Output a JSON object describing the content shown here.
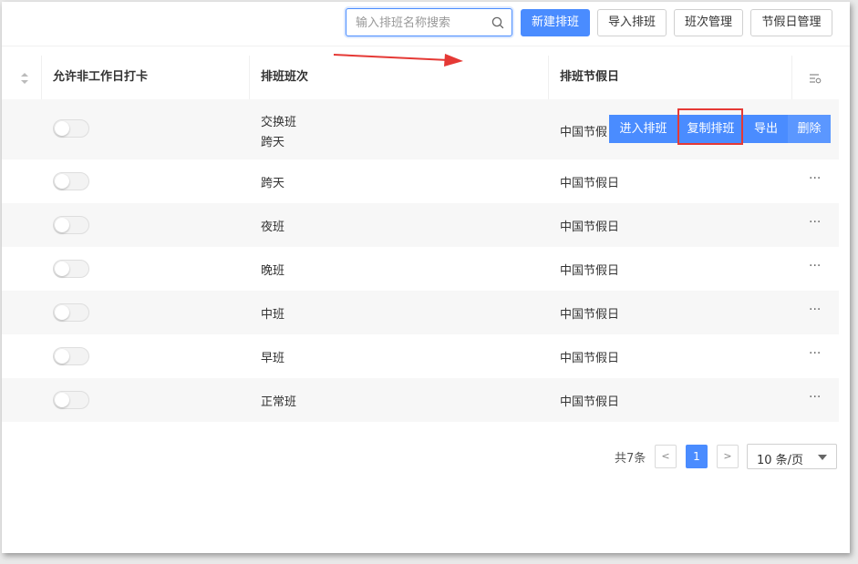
{
  "toolbar": {
    "search_placeholder": "输入排班名称搜索",
    "new_label": "新建排班",
    "import_label": "导入排班",
    "shift_label": "班次管理",
    "holiday_label": "节假日管理"
  },
  "table": {
    "headers": [
      "允许非工作日打卡",
      "排班班次",
      "排班节假日"
    ],
    "rows": [
      {
        "shift_line1": "交换班",
        "shift_line2": "跨天",
        "holiday": "中国节假日",
        "allow_nonworkday": false
      },
      {
        "shift_line1": "跨天",
        "holiday": "中国节假日",
        "allow_nonworkday": false
      },
      {
        "shift_line1": "夜班",
        "holiday": "中国节假日",
        "allow_nonworkday": false
      },
      {
        "shift_line1": "晚班",
        "holiday": "中国节假日",
        "allow_nonworkday": false
      },
      {
        "shift_line1": "中班",
        "holiday": "中国节假日",
        "allow_nonworkday": false
      },
      {
        "shift_line1": "早班",
        "holiday": "中国节假日",
        "allow_nonworkday": false
      },
      {
        "shift_line1": "正常班",
        "holiday": "中国节假日",
        "allow_nonworkday": false
      }
    ],
    "more_label": "···",
    "row_actions": {
      "enter": "进入排班",
      "copy": "复制排班",
      "export": "导出",
      "delete": "删除"
    }
  },
  "pagination": {
    "total": "共7条",
    "prev": "<",
    "page": "1",
    "next": ">",
    "page_size": "10 条/页"
  },
  "icons": {
    "search": "search-icon",
    "sort": "sort-icon",
    "column_settings": "column-settings-icon",
    "arrow": "red-arrow-annotation"
  },
  "colors": {
    "primary": "#4a8cff",
    "highlight": "#e53935",
    "row_alt": "#f7f7f7"
  }
}
